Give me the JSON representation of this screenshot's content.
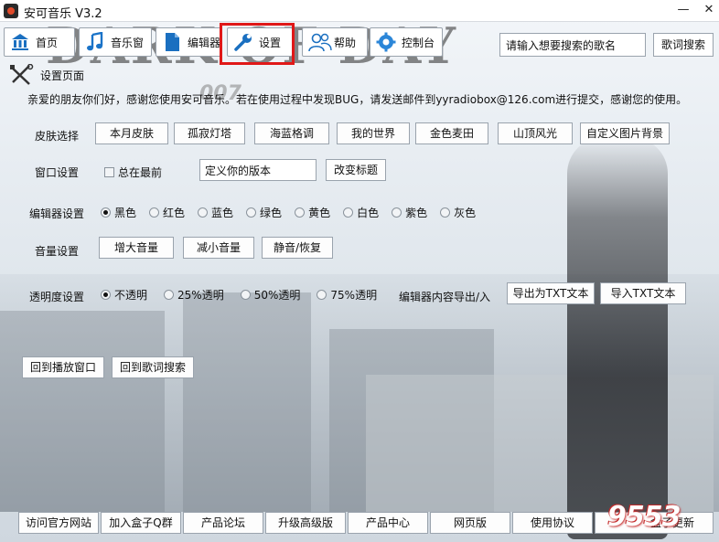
{
  "window": {
    "title": "安可音乐 V3.2",
    "minimize": "—",
    "close": "✕"
  },
  "background": {
    "title_text": "DARK OF DAY",
    "sub_text": "007"
  },
  "toolbar": {
    "home": "首页",
    "music": "音乐窗",
    "editor": "编辑器",
    "settings": "设置",
    "help": "帮助",
    "console": "控制台",
    "search_value": "请输入想要搜索的歌名",
    "search_button": "歌词搜索"
  },
  "section": {
    "title": "设置页面"
  },
  "notice": "亲爱的朋友你们好，感谢您使用安可音乐。若在使用过程中发现BUG，请发送邮件到yyradiobox@126.com进行提交，感谢您的使用。",
  "skin": {
    "label": "皮肤选择",
    "options": [
      "本月皮肤",
      "孤寂灯塔",
      "海蓝格调",
      "我的世界",
      "金色麦田",
      "山顶风光",
      "自定义图片背景"
    ]
  },
  "window_settings": {
    "label": "窗口设置",
    "topmost_label": "总在最前",
    "topmost_checked": false,
    "title_value": "定义你的版本",
    "change_title": "改变标题"
  },
  "editor_settings": {
    "label": "编辑器设置",
    "colors": [
      "黑色",
      "红色",
      "蓝色",
      "绿色",
      "黄色",
      "白色",
      "紫色",
      "灰色"
    ],
    "selected": "黑色"
  },
  "volume": {
    "label": "音量设置",
    "increase": "增大音量",
    "decrease": "减小音量",
    "mute": "静音/恢复"
  },
  "opacity": {
    "label": "透明度设置",
    "options": [
      "不透明",
      "25%透明",
      "50%透明",
      "75%透明"
    ],
    "selected": "不透明",
    "export_label": "编辑器内容导出/入",
    "export_txt": "导出为TXT文本",
    "import_txt": "导入TXT文本"
  },
  "nav_back": {
    "player": "回到播放窗口",
    "lyrics": "回到歌词搜索"
  },
  "footer": [
    "访问官方网站",
    "加入盒子Q群",
    "产品论坛",
    "升级高级版",
    "产品中心",
    "网页版",
    "使用协议",
    "盒子更新"
  ],
  "watermark": "9553",
  "colors": {
    "highlight": "#e01818",
    "accent_blue": "#1a73c8"
  }
}
